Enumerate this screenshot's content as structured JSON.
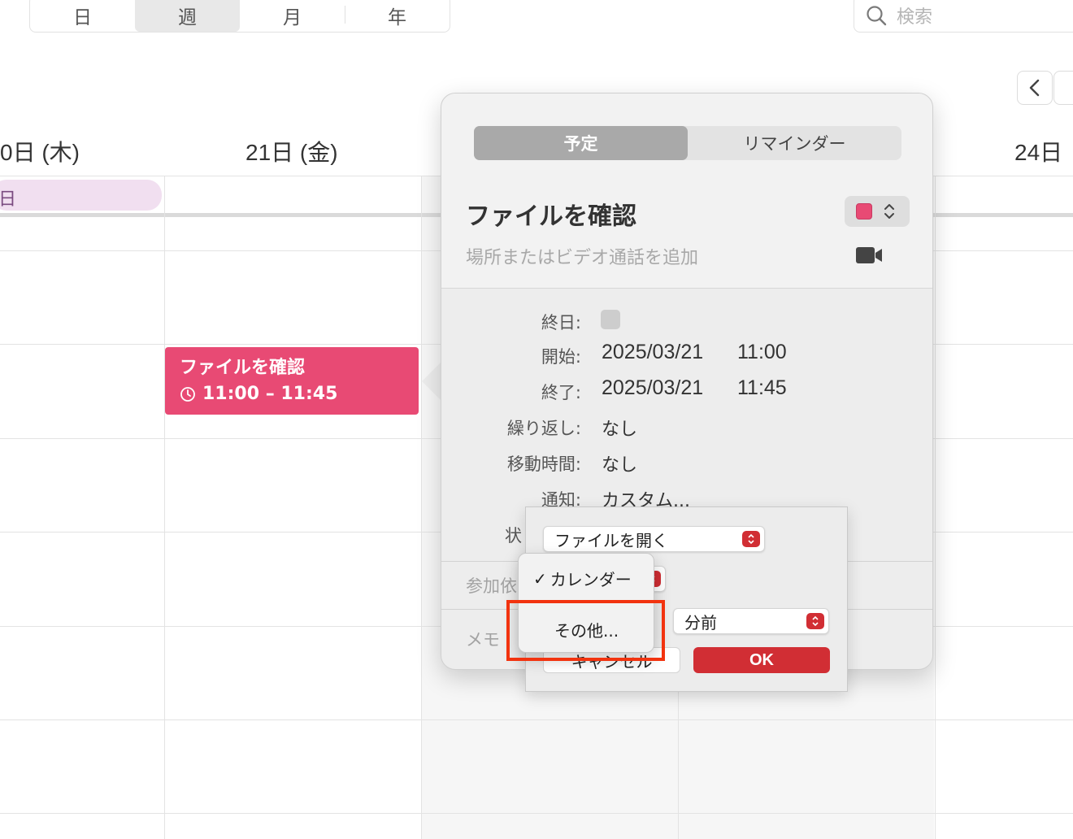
{
  "toolbar": {
    "view_tabs": [
      "日",
      "週",
      "月",
      "年"
    ],
    "active_view": "週",
    "search_placeholder": "検索"
  },
  "calendar": {
    "day_headers": [
      "0日 (木)",
      "21日 (金)",
      "24日"
    ],
    "allday_event_label": "日",
    "event": {
      "title": "ファイルを確認",
      "time": "11:00 – 11:45",
      "color": "#e84a74"
    }
  },
  "popover": {
    "tabs": [
      "予定",
      "リマインダー"
    ],
    "active_tab": "予定",
    "title": "ファイルを確認",
    "calendar_color": "#e84a74",
    "location_placeholder": "場所またはビデオ通話を追加",
    "fields": {
      "allday_label": "終日:",
      "start_label": "開始:",
      "start_date": "2025/03/21",
      "start_time": "11:00",
      "end_label": "終了:",
      "end_date": "2025/03/21",
      "end_time": "11:45",
      "repeat_label": "繰り返し:",
      "repeat_value": "なし",
      "travel_label": "移動時間:",
      "travel_value": "なし",
      "alert_label": "通知:",
      "alert_value": "カスタム...",
      "status_label_partial": "状",
      "invitees_partial": "参加依",
      "notes_partial": "メモ"
    }
  },
  "dialog": {
    "action_select": "ファイルを開く",
    "unit_select": "分前",
    "cancel_label": "キャンセル",
    "ok_label": "OK"
  },
  "menu": {
    "items": [
      "カレンダー",
      "その他..."
    ],
    "checked_item": "カレンダー"
  },
  "colors": {
    "accent_red": "#d12e34",
    "highlight": "#f2330f"
  }
}
